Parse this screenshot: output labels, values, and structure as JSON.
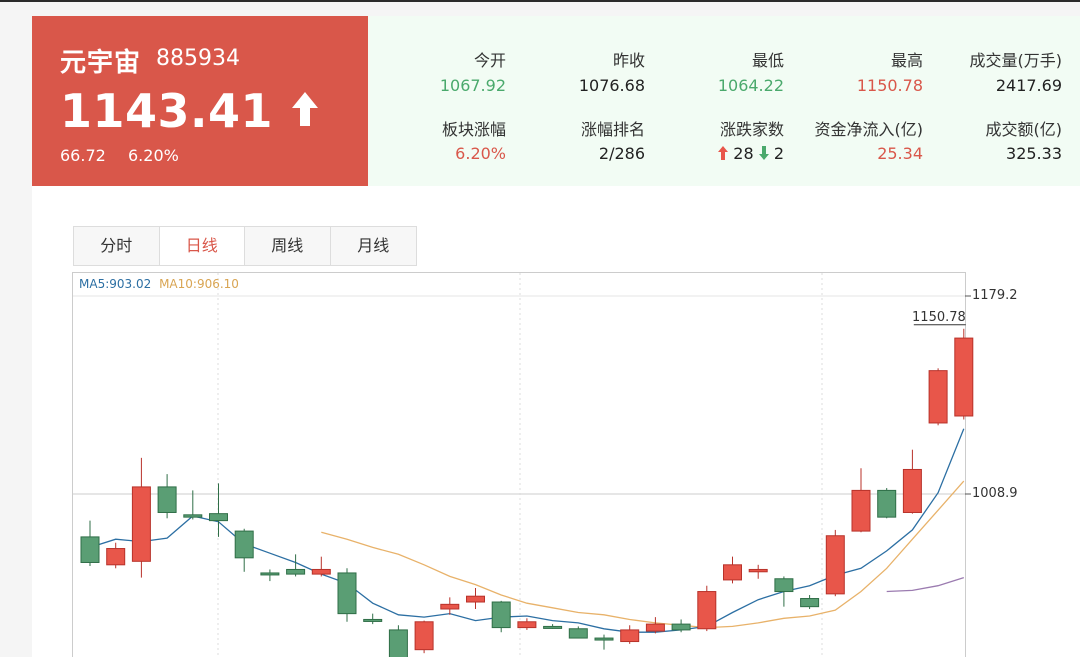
{
  "header": {
    "name": "元宇宙",
    "code": "885934",
    "price": "1143.41",
    "change": "66.72",
    "change_pct": "6.20%",
    "trend_icon": "up-arrow-icon"
  },
  "stats": {
    "row1": [
      {
        "label": "今开",
        "value": "1067.92",
        "color": "green"
      },
      {
        "label": "昨收",
        "value": "1076.68",
        "color": "normal"
      },
      {
        "label": "最低",
        "value": "1064.22",
        "color": "green"
      },
      {
        "label": "最高",
        "value": "1150.78",
        "color": "red"
      },
      {
        "label": "成交量(万手)",
        "value": "2417.69",
        "color": "normal"
      }
    ],
    "row2": [
      {
        "label": "板块涨幅",
        "value": "6.20%",
        "color": "red"
      },
      {
        "label": "涨幅排名",
        "value": "2/286",
        "color": "normal"
      },
      {
        "label": "涨跌家数",
        "up": "28",
        "down": "2"
      },
      {
        "label": "资金净流入(亿)",
        "value": "25.34",
        "color": "red"
      },
      {
        "label": "成交额(亿)",
        "value": "325.33",
        "color": "normal"
      }
    ]
  },
  "tabs": [
    {
      "label": "分时",
      "active": false
    },
    {
      "label": "日线",
      "active": true
    },
    {
      "label": "周线",
      "active": false
    },
    {
      "label": "月线",
      "active": false
    }
  ],
  "chart": {
    "ma5_label": "MA5:903.02",
    "ma10_label": "MA10:906.10",
    "axis_top": "1179.2",
    "axis_mid": "1008.9",
    "max_label": "1150.78",
    "colors": {
      "up": "#e8564a",
      "down": "#5a9e74",
      "ma5": "#2c6fa3",
      "ma10": "#e8b26a",
      "ma20": "#9b7bb0"
    }
  },
  "chart_data": {
    "type": "candlestick",
    "ylim": [
      760,
      1179.2
    ],
    "candles": [
      {
        "o": 972,
        "c": 950,
        "h": 986,
        "l": 947
      },
      {
        "o": 948,
        "c": 962,
        "h": 967,
        "l": 945
      },
      {
        "o": 951,
        "c": 1015,
        "h": 1040,
        "l": 937
      },
      {
        "o": 1015,
        "c": 993,
        "h": 1026,
        "l": 988
      },
      {
        "o": 991,
        "c": 989,
        "h": 1012,
        "l": 987
      },
      {
        "o": 992,
        "c": 986,
        "h": 1018,
        "l": 972
      },
      {
        "o": 977,
        "c": 954,
        "h": 979,
        "l": 942
      },
      {
        "o": 941,
        "c": 940,
        "h": 944,
        "l": 934
      },
      {
        "o": 944,
        "c": 940,
        "h": 957,
        "l": 938
      },
      {
        "o": 940,
        "c": 944,
        "h": 955,
        "l": 938
      },
      {
        "o": 941,
        "c": 906,
        "h": 945,
        "l": 899
      },
      {
        "o": 901,
        "c": 900,
        "h": 906,
        "l": 897
      },
      {
        "o": 892,
        "c": 860,
        "h": 896,
        "l": 850
      },
      {
        "o": 875,
        "c": 899,
        "h": 900,
        "l": 872
      },
      {
        "o": 910,
        "c": 914,
        "h": 920,
        "l": 905
      },
      {
        "o": 916,
        "c": 921,
        "h": 928,
        "l": 910
      },
      {
        "o": 916,
        "c": 894,
        "h": 917,
        "l": 890
      },
      {
        "o": 894,
        "c": 899,
        "h": 902,
        "l": 892
      },
      {
        "o": 895,
        "c": 894,
        "h": 897,
        "l": 893
      },
      {
        "o": 893,
        "c": 885,
        "h": 895,
        "l": 885
      },
      {
        "o": 885,
        "c": 884,
        "h": 888,
        "l": 875
      },
      {
        "o": 882,
        "c": 892,
        "h": 896,
        "l": 880
      },
      {
        "o": 891,
        "c": 897,
        "h": 903,
        "l": 889
      },
      {
        "o": 897,
        "c": 892,
        "h": 901,
        "l": 890
      },
      {
        "o": 893,
        "c": 925,
        "h": 930,
        "l": 891
      },
      {
        "o": 935,
        "c": 948,
        "h": 955,
        "l": 932
      },
      {
        "o": 942,
        "c": 944,
        "h": 948,
        "l": 936
      },
      {
        "o": 936,
        "c": 925,
        "h": 938,
        "l": 912
      },
      {
        "o": 919,
        "c": 912,
        "h": 922,
        "l": 910
      },
      {
        "o": 923,
        "c": 973,
        "h": 978,
        "l": 921
      },
      {
        "o": 977,
        "c": 1012,
        "h": 1031,
        "l": 976
      },
      {
        "o": 1012,
        "c": 989,
        "h": 1014,
        "l": 988
      },
      {
        "o": 993,
        "c": 1030,
        "h": 1047,
        "l": 992
      },
      {
        "o": 1070,
        "c": 1115,
        "h": 1117,
        "l": 1068
      },
      {
        "o": 1076,
        "c": 1143,
        "h": 1151,
        "l": 1073
      }
    ],
    "ma5": [
      963,
      970,
      968,
      971,
      990,
      985,
      966,
      958,
      950,
      940,
      932,
      915,
      905,
      903,
      906,
      900,
      903,
      904,
      900,
      898,
      893,
      890,
      890,
      892,
      895,
      907,
      918,
      925,
      930,
      939,
      945,
      960,
      978,
      1010,
      1065
    ],
    "ma10": [
      null,
      null,
      null,
      null,
      null,
      null,
      null,
      null,
      null,
      976,
      970,
      963,
      957,
      948,
      938,
      931,
      922,
      915,
      911,
      907,
      905,
      901,
      898,
      896,
      894,
      895,
      898,
      902,
      904,
      909,
      925,
      945,
      970,
      995,
      1020
    ],
    "ma20": [
      null,
      null,
      null,
      null,
      null,
      null,
      null,
      null,
      null,
      null,
      null,
      null,
      null,
      null,
      null,
      null,
      null,
      null,
      null,
      null,
      null,
      null,
      null,
      null,
      null,
      null,
      null,
      null,
      null,
      null,
      null,
      925,
      926,
      930,
      937
    ]
  }
}
